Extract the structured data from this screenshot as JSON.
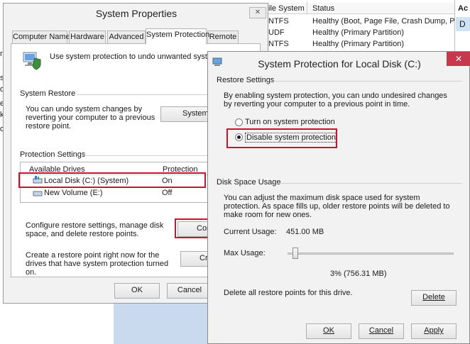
{
  "background": {
    "col_file_system": "ile System",
    "col_status": "Status",
    "col_actions": "Ac",
    "actions_sel": "D",
    "rows": [
      {
        "fs": "NTFS",
        "status": "Healthy (Boot, Page File, Crash Dump, Pri"
      },
      {
        "fs": "UDF",
        "status": "Healthy (Primary Partition)"
      },
      {
        "fs": "NTFS",
        "status": "Healthy (Primary Partition)"
      }
    ],
    "left_chars": [
      "r",
      "s",
      "o",
      "e",
      "k",
      "o"
    ]
  },
  "system_properties": {
    "title": "System Properties",
    "close": "✕",
    "tabs": [
      "Computer Name",
      "Hardware",
      "Advanced",
      "System Protection",
      "Remote"
    ],
    "intro": "Use system protection to undo unwanted system cha",
    "restore_group": "System Restore",
    "restore_text": "You can undo system changes by reverting your computer to a previous restore point.",
    "restore_button": "System R",
    "protection_group": "Protection Settings",
    "col_drives": "Available Drives",
    "col_protection": "Protection",
    "drives": [
      {
        "name": "Local Disk (C:) (System)",
        "protection": "On"
      },
      {
        "name": "New Volume (E:)",
        "protection": "Off"
      }
    ],
    "configure_text": "Configure restore settings, manage disk space, and delete restore points.",
    "configure_button": "Con",
    "create_text": "Create a restore point right now for the drives that have system protection turned on.",
    "create_button": "Cre",
    "ok": "OK",
    "cancel": "Cancel"
  },
  "dialog": {
    "title": "System Protection for Local Disk (C:)",
    "close": "✕",
    "restore_settings": "Restore Settings",
    "restore_desc": "By enabling system protection, you can undo undesired changes by reverting your computer to a previous point in time.",
    "option_on": "Turn on system protection",
    "option_off": "Disable system protection",
    "disk_usage": "Disk Space Usage",
    "usage_desc": "You can adjust the maximum disk space used for system protection. As space fills up, older restore points will be deleted to make room for new ones.",
    "current_usage_label": "Current Usage:",
    "current_usage_value": "451.00 MB",
    "max_usage_label": "Max Usage:",
    "max_usage_fraction": 0.03,
    "max_usage_value": "3% (756.31 MB)",
    "delete_text": "Delete all restore points for this drive.",
    "delete_button": "Delete",
    "ok": "OK",
    "cancel": "Cancel",
    "apply": "Apply"
  },
  "colors": {
    "highlight": "#d01030",
    "close_red": "#c7384c"
  }
}
